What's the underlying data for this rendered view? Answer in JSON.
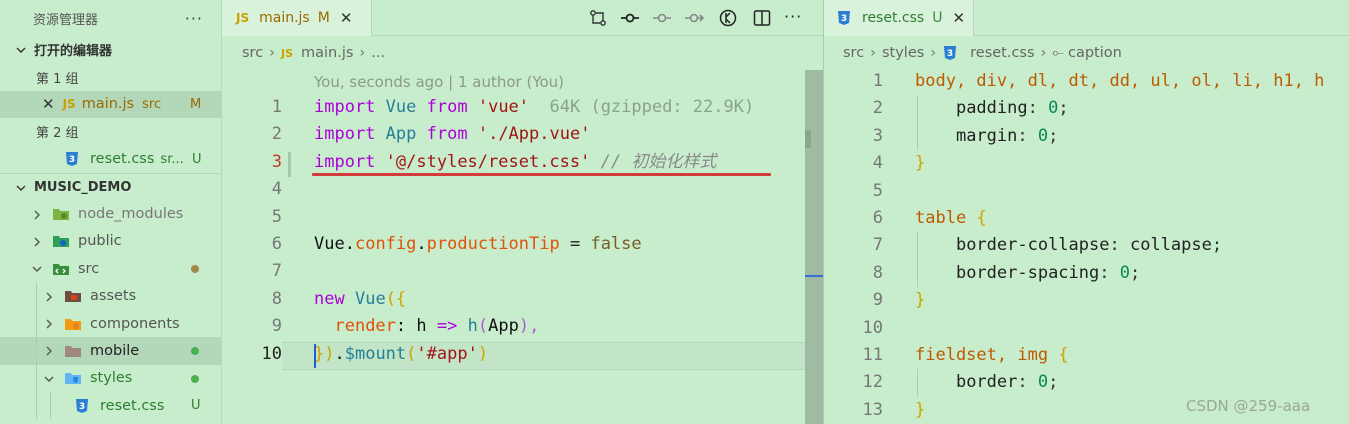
{
  "sidebar": {
    "title": "资源管理器",
    "more": "···",
    "open_editors": "打开的编辑器",
    "group1": "第 1 组",
    "group1_file": {
      "name": "main.js",
      "folder": "src",
      "status": "M"
    },
    "group2": "第 2 组",
    "group2_file": {
      "name": "reset.css",
      "folder": "sr...",
      "status": "U"
    },
    "project": "MUSIC_DEMO",
    "tree": [
      {
        "label": "node_modules"
      },
      {
        "label": "public"
      },
      {
        "label": "src"
      },
      {
        "label": "assets"
      },
      {
        "label": "components"
      },
      {
        "label": "mobile"
      },
      {
        "label": "styles"
      },
      {
        "label": "reset.css",
        "status": "U"
      }
    ]
  },
  "left_editor": {
    "tab": {
      "name": "main.js",
      "status": "M",
      "close": "✕"
    },
    "breadcrumb": [
      "src",
      "main.js",
      "..."
    ],
    "blame": "You, seconds ago | 1 author (You)",
    "line_numbers": [
      "1",
      "2",
      "3",
      "4",
      "5",
      "6",
      "7",
      "8",
      "9",
      "10"
    ],
    "lines": {
      "l1": {
        "kw": "import",
        "cls": "Vue",
        "kw2": "from",
        "str": "'vue'",
        "hint": "64K (gzipped: 22.9K)"
      },
      "l2": {
        "kw": "import",
        "cls": "App",
        "kw2": "from",
        "str": "'./App.vue'"
      },
      "l3": {
        "kw": "import",
        "str": "'@/styles/reset.css'",
        "cmt": "// 初始化样式"
      },
      "l5": {
        "obj": "Vue",
        "p1": "config",
        "p2": "productionTip",
        "op": "=",
        "val": "false"
      },
      "l7": {
        "kw": "new",
        "cls": "Vue",
        "br": "({"
      },
      "l8": {
        "prop": "render",
        "colon": ":",
        "arg": "h",
        "arrow": "=>",
        "fn": "h",
        "open": "(",
        "app": "App",
        "close": "),"
      },
      "l9": {
        "br": "})",
        "dot": ".",
        "fn": "$mount",
        "open": "(",
        "str": "'#app'",
        "close": ")"
      }
    }
  },
  "right_editor": {
    "tab": {
      "name": "reset.css",
      "status": "U",
      "close": "✕"
    },
    "breadcrumb": [
      "src",
      "styles",
      "reset.css",
      "caption"
    ],
    "line_numbers": [
      "1",
      "2",
      "3",
      "4",
      "5",
      "6",
      "7",
      "8",
      "9",
      "10",
      "11",
      "12",
      "13"
    ],
    "lines": {
      "l1": "body, div, dl, dt, dd, ul, ol, li, h1, h",
      "l2": {
        "prop": "padding",
        "val": "0"
      },
      "l3": {
        "prop": "margin",
        "val": "0"
      },
      "l4": "}",
      "l6": "table",
      "l7": {
        "prop": "border-collapse",
        "val": "collapse"
      },
      "l8": {
        "prop": "border-spacing",
        "val": "0"
      },
      "l9": "}",
      "l11": "fieldset, img",
      "l12": {
        "prop": "border",
        "val": "0"
      },
      "l13": "}"
    }
  },
  "watermark": "CSDN @259-aaa",
  "colors": {
    "background": "#c7edcc",
    "underline": "#d63b3b",
    "cursor": "#1f5fd1"
  }
}
